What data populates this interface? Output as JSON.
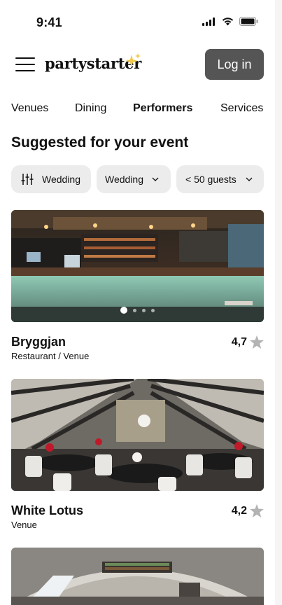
{
  "status_bar": {
    "time": "9:41"
  },
  "header": {
    "logo": "partystarter",
    "login_label": "Log in"
  },
  "tabs": [
    {
      "label": "Venues",
      "active": false
    },
    {
      "label": "Dining",
      "active": false
    },
    {
      "label": "Performers",
      "active": true
    },
    {
      "label": "Services",
      "active": false
    }
  ],
  "section": {
    "title": "Suggested for your event"
  },
  "filters": {
    "event_type": "Wedding",
    "occasion": "Wedding",
    "guests": "< 50 guests"
  },
  "listings": [
    {
      "name": "Bryggjan",
      "category": "Restaurant / Venue",
      "rating": "4,7"
    },
    {
      "name": "White Lotus",
      "category": "Venue",
      "rating": "4,2"
    }
  ],
  "colors": {
    "login_bg": "#555555",
    "chip_bg": "#ececec",
    "star": "#b3b3b3",
    "sparkle": "#f2c94c"
  },
  "icons": [
    "menu-icon",
    "sparkle-icon",
    "sliders-icon",
    "chevron-down-icon",
    "star-icon",
    "signal-icon",
    "wifi-icon",
    "battery-icon"
  ]
}
